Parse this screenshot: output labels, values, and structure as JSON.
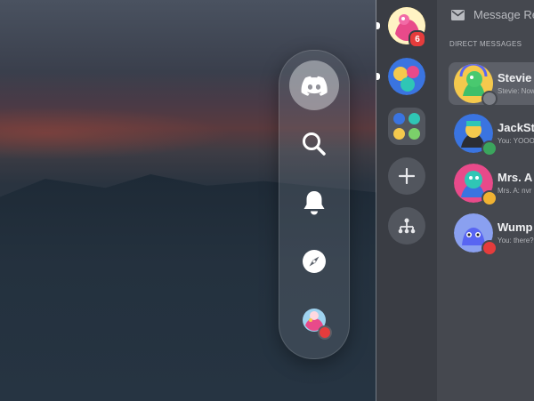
{
  "wallpaper": {
    "kind": "dusk-landscape"
  },
  "floating_nav": {
    "items": [
      {
        "name": "discord-home",
        "icon": "discord-logo-icon",
        "active": true
      },
      {
        "name": "search",
        "icon": "search-icon",
        "active": false
      },
      {
        "name": "notifications",
        "icon": "bell-icon",
        "active": false
      },
      {
        "name": "explore",
        "icon": "compass-icon",
        "active": false
      },
      {
        "name": "profile",
        "icon": "avatar-icon",
        "active": false
      }
    ]
  },
  "servers": {
    "items": [
      {
        "name": "server-1",
        "badge": "6",
        "unread": true
      },
      {
        "name": "server-2",
        "unread": true
      },
      {
        "name": "server-folder",
        "unread": false
      }
    ],
    "add_icon": "plus-icon",
    "discover_icon": "hierarchy-icon"
  },
  "dm_panel": {
    "header_icon": "mail-icon",
    "header_text": "Message Re",
    "section_label": "DIRECT MESSAGES",
    "rows": [
      {
        "name": "Stevie",
        "preview": "Stevie: Now",
        "status": "idle",
        "status_color": "#7d8088",
        "avatar_color": "#f5c94d",
        "selected": true
      },
      {
        "name": "JackSto",
        "preview": "You: YOOO",
        "status": "online",
        "status_color": "#3ba55d",
        "avatar_color": "#3a74e0",
        "selected": false
      },
      {
        "name": "Mrs. A",
        "preview": "Mrs. A: nvr",
        "status": "idle",
        "status_color": "#f0b232",
        "avatar_color": "#2fc6b5",
        "selected": false
      },
      {
        "name": "Wump",
        "preview": "You: there?",
        "status": "dnd",
        "status_color": "#e53c3c",
        "avatar_color": "#7289da",
        "selected": false
      }
    ]
  }
}
